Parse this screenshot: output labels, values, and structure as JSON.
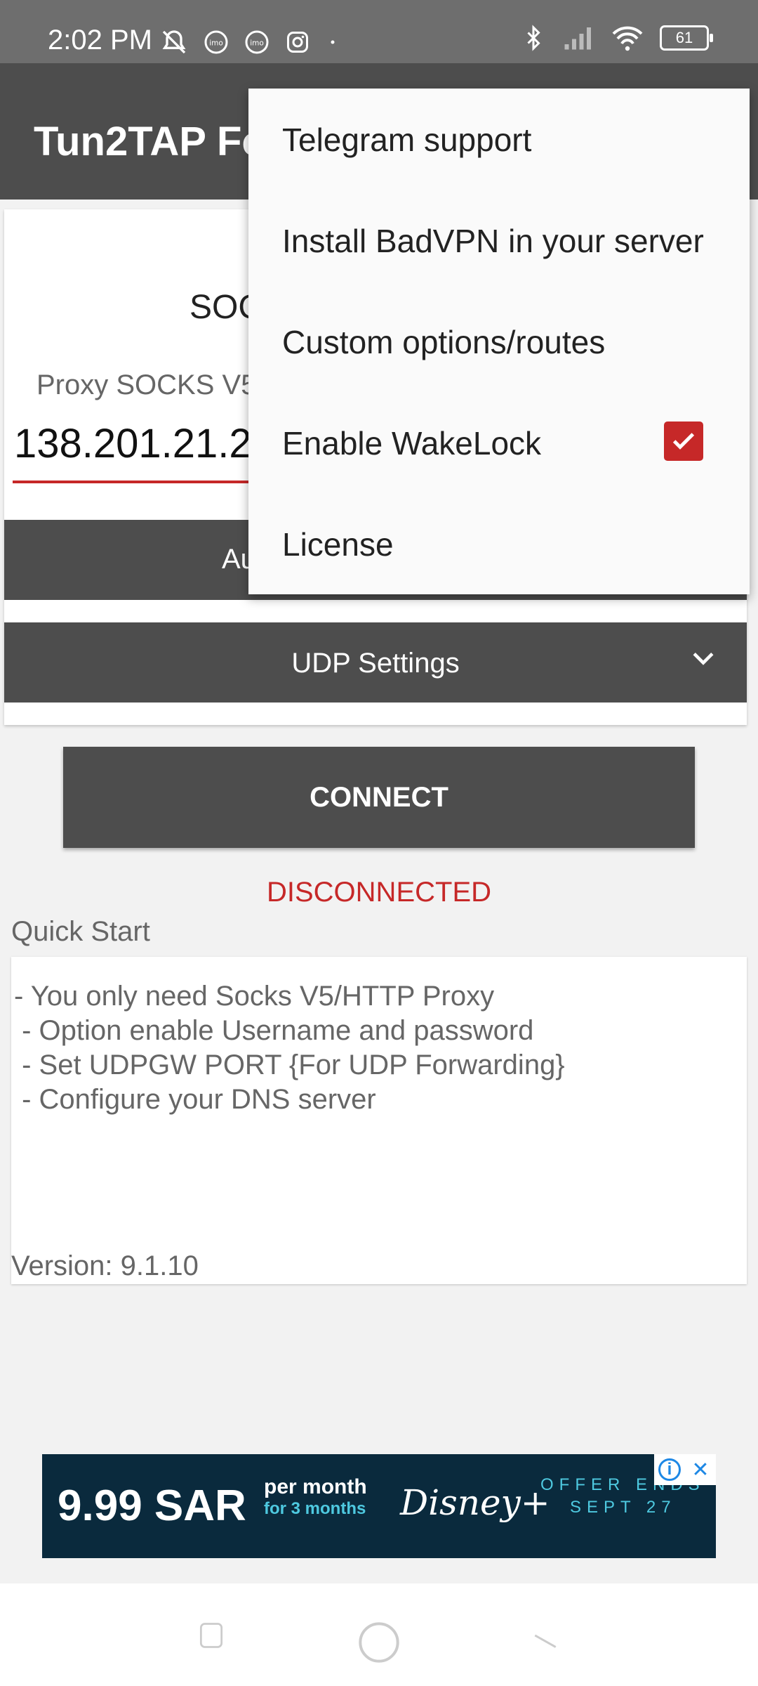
{
  "status_bar": {
    "time": "2:02 PM",
    "left_icons": [
      "bell-off-icon",
      "imo-icon",
      "imo-icon",
      "instagram-icon",
      "dot-icon"
    ],
    "right_icons": [
      "bluetooth-icon",
      "signal-icon",
      "wifi-icon"
    ],
    "battery": "61"
  },
  "app_bar": {
    "title": "Tun2TAP Fo"
  },
  "card": {
    "title": "SOC",
    "proxy_label": "Proxy SOCKS V5",
    "proxy_value": "138.201.21.23",
    "auth_label": "Au",
    "udp_label": "UDP Settings"
  },
  "connect": {
    "label": "CONNECT"
  },
  "status": {
    "text": "DISCONNECTED",
    "color": "#c62828"
  },
  "quick_start": {
    "label": "Quick Start",
    "lines": [
      "- You only need Socks V5/HTTP Proxy",
      " - Option enable Username and password",
      " - Set UDPGW PORT {For UDP Forwarding}",
      " - Configure your DNS server"
    ],
    "version": "Version: 9.1.10"
  },
  "menu": {
    "items": [
      "Telegram support",
      "Install BadVPN in your server",
      "Custom options/routes",
      "Enable WakeLock",
      "License"
    ],
    "wakelock_checked": true
  },
  "ad": {
    "price": "9.99 SAR",
    "per_month": "per month",
    "for_months": "for 3 months",
    "brand": "Disney+",
    "offer": "OFFER ENDS",
    "date": "SEPT 27"
  },
  "colors": {
    "accent": "#c62828",
    "bar": "#4d4d4d",
    "status_bar": "#6e6e6e"
  }
}
